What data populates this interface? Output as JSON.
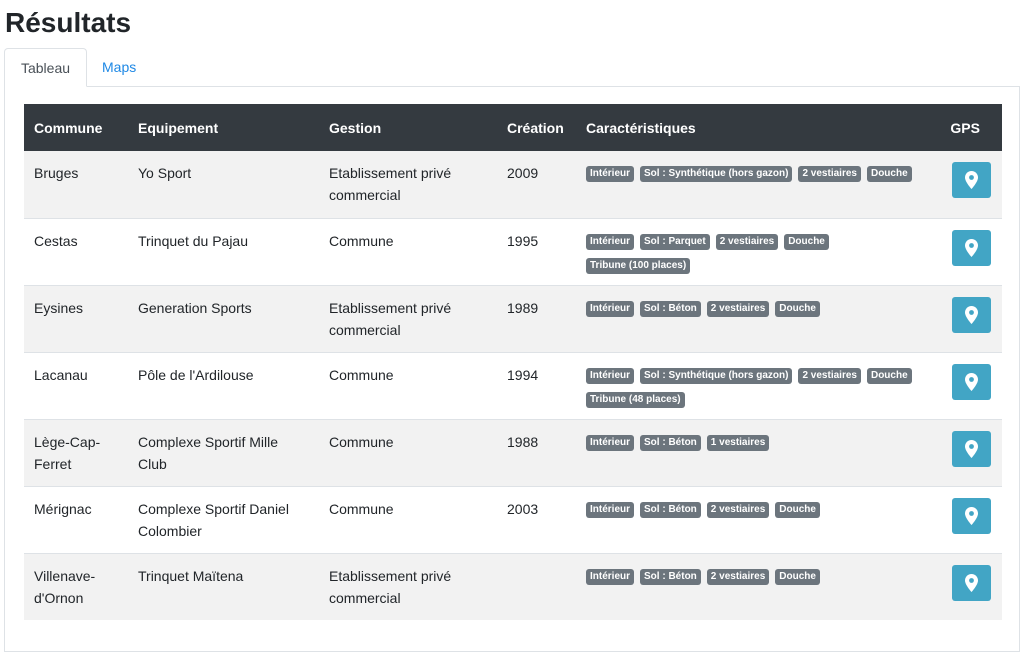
{
  "page": {
    "title": "Résultats"
  },
  "tabs": [
    {
      "label": "Tableau",
      "active": true
    },
    {
      "label": "Maps",
      "active": false
    }
  ],
  "table": {
    "headers": [
      "Commune",
      "Equipement",
      "Gestion",
      "Création",
      "Caractéristiques",
      "GPS"
    ],
    "rows": [
      {
        "commune": "Bruges",
        "equipement": "Yo Sport",
        "gestion": "Etablissement privé commercial",
        "creation": "2009",
        "tags": [
          "Intérieur",
          "Sol : Synthétique (hors gazon)",
          "2 vestiaires",
          "Douche"
        ]
      },
      {
        "commune": "Cestas",
        "equipement": "Trinquet du Pajau",
        "gestion": "Commune",
        "creation": "1995",
        "tags": [
          "Intérieur",
          "Sol : Parquet",
          "2 vestiaires",
          "Douche",
          "Tribune (100 places)"
        ]
      },
      {
        "commune": "Eysines",
        "equipement": "Generation Sports",
        "gestion": "Etablissement privé commercial",
        "creation": "1989",
        "tags": [
          "Intérieur",
          "Sol : Béton",
          "2 vestiaires",
          "Douche"
        ]
      },
      {
        "commune": "Lacanau",
        "equipement": "Pôle de l'Ardilouse",
        "gestion": "Commune",
        "creation": "1994",
        "tags": [
          "Intérieur",
          "Sol : Synthétique (hors gazon)",
          "2 vestiaires",
          "Douche",
          "Tribune (48 places)"
        ]
      },
      {
        "commune": "Lège-Cap-Ferret",
        "equipement": "Complexe Sportif Mille Club",
        "gestion": "Commune",
        "creation": "1988",
        "tags": [
          "Intérieur",
          "Sol : Béton",
          "1 vestiaires"
        ]
      },
      {
        "commune": "Mérignac",
        "equipement": "Complexe Sportif Daniel Colombier",
        "gestion": "Commune",
        "creation": "2003",
        "tags": [
          "Intérieur",
          "Sol : Béton",
          "2 vestiaires",
          "Douche"
        ]
      },
      {
        "commune": "Villenave-d'Ornon",
        "equipement": "Trinquet Maïtena",
        "gestion": "Etablissement privé commercial",
        "creation": "",
        "tags": [
          "Intérieur",
          "Sol : Béton",
          "2 vestiaires",
          "Douche"
        ]
      }
    ]
  },
  "icons": {
    "gps": "map-marker-icon"
  },
  "colors": {
    "header_bg": "#343a40",
    "badge_bg": "#6c757d",
    "gps_button": "#42a5c5",
    "tab_link": "#1e88e5"
  }
}
